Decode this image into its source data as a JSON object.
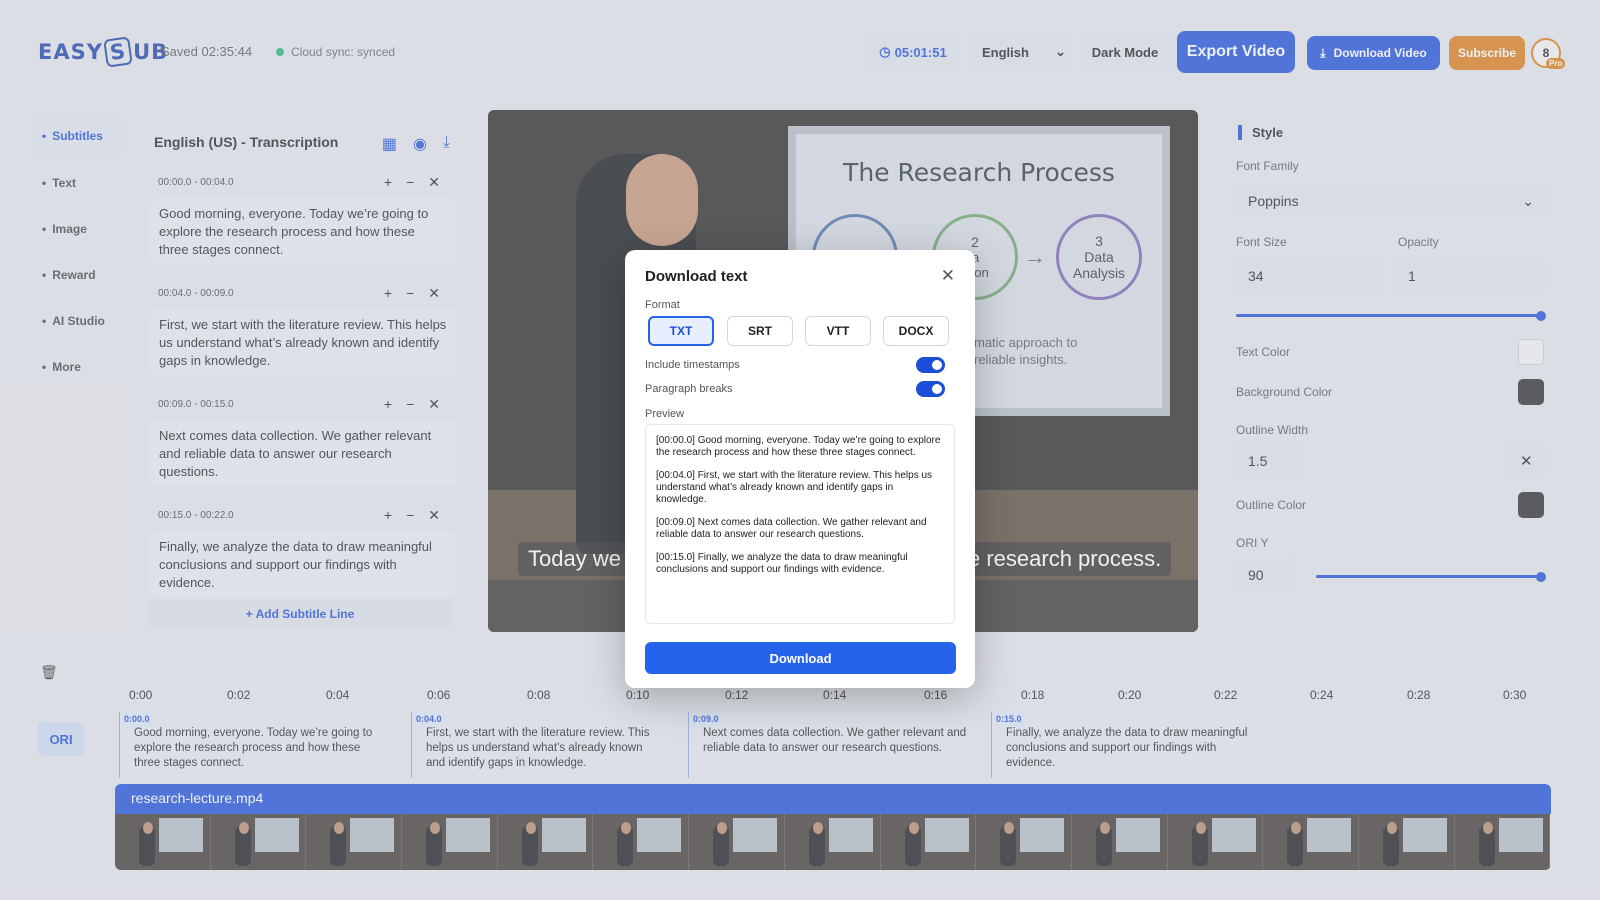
{
  "header": {
    "logo_text_a": "EASY",
    "logo_text_b": "S",
    "logo_text_c": "UB",
    "saved": "Saved 02:35:44",
    "sync": "Cloud sync: synced",
    "timer": "05:01:51",
    "language": "English",
    "dark_mode": "Dark Mode",
    "export": "Export Video",
    "download_video": "Download Video",
    "subscribe": "Subscribe",
    "avatar": "8",
    "pro": "Pro"
  },
  "nav": [
    {
      "label": "Subtitles"
    },
    {
      "label": "Text"
    },
    {
      "label": "Image"
    },
    {
      "label": "Reward"
    },
    {
      "label": "AI Studio"
    },
    {
      "label": "More"
    }
  ],
  "transcription": {
    "title": "English (US) - Transcription",
    "segments": [
      {
        "time": "00:00.0 - 00:04.0",
        "text": "Good morning, everyone. Today we’re going to explore the research process and how these three stages connect."
      },
      {
        "time": "00:04.0 - 00:09.0",
        "text": "First, we start with the literature review. This helps us understand what’s already known and identify gaps in knowledge."
      },
      {
        "time": "00:09.0 - 00:15.0",
        "text": "Next comes data collection. We gather relevant and reliable data to answer our research questions."
      },
      {
        "time": "00:15.0 - 00:22.0",
        "text": "Finally, we analyze the data to draw meaningful conclusions and support our findings with evidence."
      }
    ],
    "add_line": "+ Add Subtitle Line"
  },
  "video": {
    "slide_title": "The Research Process",
    "step1": "1",
    "step2_num": "2",
    "step2_text": "ata\nction",
    "step3_num": "3",
    "step3_a": "Data",
    "step3_b": "Analysis",
    "slide_sub": "matic approach to\nreliable insights.",
    "caption_left": "Today we",
    "caption_right": "e research process."
  },
  "modal": {
    "title": "Download text",
    "format_label": "Format",
    "formats": [
      "TXT",
      "SRT",
      "VTT",
      "DOCX"
    ],
    "selected_format": "TXT",
    "include_timestamps": "Include timestamps",
    "paragraph_breaks": "Paragraph breaks",
    "preview_label": "Preview",
    "preview": [
      "[00:00.0] Good morning, everyone. Today we’re going to explore the research process and how these three stages connect.",
      "[00:04.0] First, we start with the literature review. This helps us understand what’s already known and identify gaps in knowledge.",
      "[00:09.0] Next comes data collection. We gather relevant and reliable data to answer our research questions.",
      "[00:15.0] Finally, we analyze the data to draw meaningful conclusions and support our findings with evidence."
    ],
    "download": "Download"
  },
  "style": {
    "title": "Style",
    "font_family_label": "Font Family",
    "font_family": "Poppins",
    "font_size_label": "Font Size",
    "font_size": "34",
    "opacity_label": "Opacity",
    "opacity": "1",
    "text_color_label": "Text Color",
    "text_color": "#f2f2f2",
    "bg_color_label": "Background Color",
    "bg_color": "#2b2b2b",
    "outline_width_label": "Outline Width",
    "outline_width": "1.5",
    "outline_color_label": "Outline Color",
    "outline_color": "#2b2b2b",
    "ori_y_label": "ORI Y",
    "ori_y": "90"
  },
  "timeline": {
    "ticks": [
      "0:00",
      "0:02",
      "0:04",
      "0:06",
      "0:08",
      "0:10",
      "0:12",
      "0:14",
      "0:16",
      "0:18",
      "0:20",
      "0:22",
      "0:24",
      "0:28",
      "0:30"
    ],
    "track_label": "ORI",
    "clips": [
      {
        "ts": "0:00.0",
        "text": "Good morning, everyone. Today we’re going to explore the research process and how these three stages connect."
      },
      {
        "ts": "0:04.0",
        "text": "First, we start with the literature review. This helps us understand what’s already known and identify gaps in knowledge."
      },
      {
        "ts": "0:09.0",
        "text": "Next comes data collection. We gather relevant and reliable data to answer our research questions."
      },
      {
        "ts": "0:15.0",
        "text": "Finally, we analyze the data to draw meaningful conclusions and support our findings with evidence."
      }
    ],
    "video_file": "research-lecture.mp4"
  },
  "colors": {
    "accent": "#1d4ed8",
    "subscribe": "#dd7c16",
    "sync": "#22b573"
  }
}
